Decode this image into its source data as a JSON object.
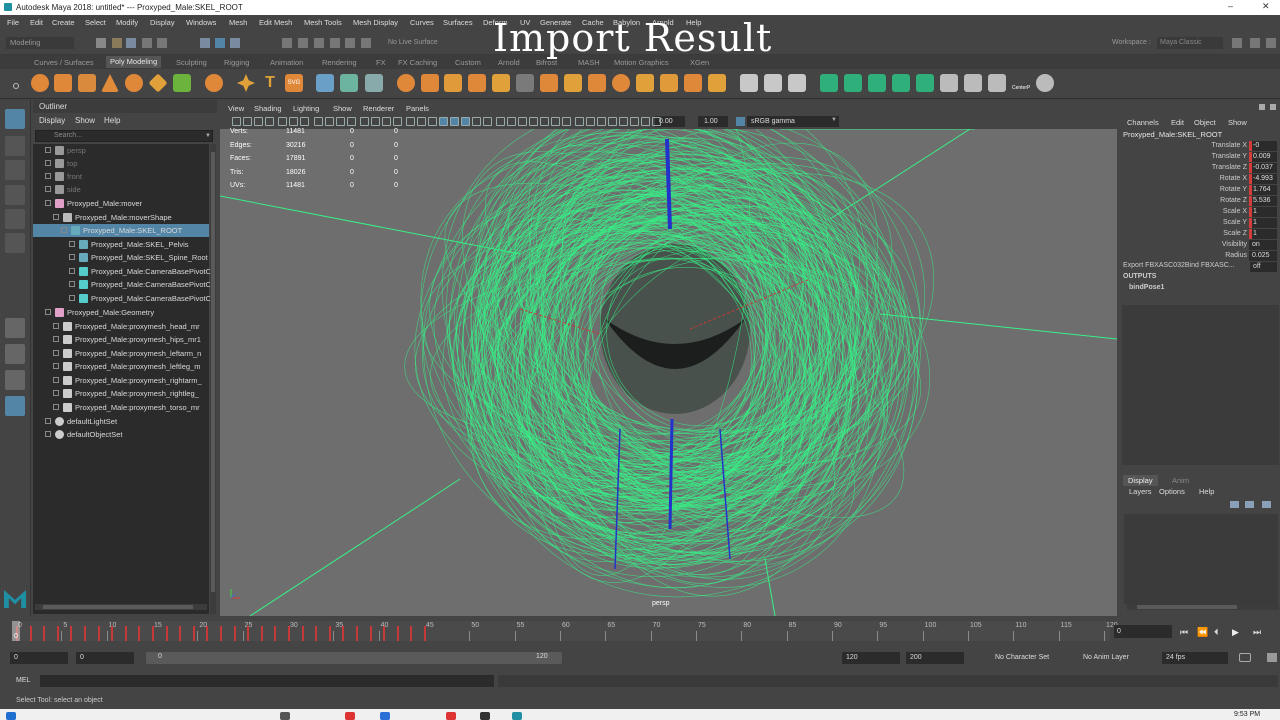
{
  "window": {
    "title": "Autodesk Maya 2018: untitled*   ---   Proxyped_Male:SKEL_ROOT",
    "minimize": "–",
    "close": "✕"
  },
  "overlay_caption": "Import Result",
  "menubar": [
    "File",
    "Edit",
    "Create",
    "Select",
    "Modify",
    "Display",
    "Windows",
    "Mesh",
    "Edit Mesh",
    "Mesh Tools",
    "Mesh Display",
    "Curves",
    "Surfaces",
    "Deform",
    "UV",
    "Generate",
    "Cache",
    "Babylon",
    "Arnold",
    "Help"
  ],
  "statusline": {
    "mode": "Modeling",
    "live_surface": "No Live Surface",
    "workspace_label": "Workspace :",
    "workspace_value": "Maya Classic"
  },
  "shelf_tabs": [
    "Curves / Surfaces",
    "Poly Modeling",
    "Sculpting",
    "Rigging",
    "Animation",
    "Rendering",
    "FX",
    "FX Caching",
    "Custom",
    "Arnold",
    "Bifrost",
    "MASH",
    "Motion Graphics",
    "XGen"
  ],
  "shelf_active": "Poly Modeling",
  "shelf_text_icons": {
    "type": "T",
    "svg": "SVG",
    "center": "CenterP"
  },
  "outliner": {
    "title": "Outliner",
    "menus": [
      "Display",
      "Show",
      "Help"
    ],
    "search_placeholder": "Search...",
    "rows": [
      {
        "label": "persp",
        "dim": true
      },
      {
        "label": "top",
        "dim": true
      },
      {
        "label": "front",
        "dim": true
      },
      {
        "label": "side",
        "dim": true
      },
      {
        "label": "Proxyped_Male:mover"
      },
      {
        "label": "Proxyped_Male:moverShape"
      },
      {
        "label": "Proxyped_Male:SKEL_ROOT",
        "selected": true
      },
      {
        "label": "Proxyped_Male:SKEL_Pelvis"
      },
      {
        "label": "Proxyped_Male:SKEL_Spine_Root"
      },
      {
        "label": "Proxyped_Male:CameraBasePivotO"
      },
      {
        "label": "Proxyped_Male:CameraBasePivotO"
      },
      {
        "label": "Proxyped_Male:CameraBasePivotO"
      },
      {
        "label": "Proxyped_Male:Geometry"
      },
      {
        "label": "Proxyped_Male:proxymesh_head_mr"
      },
      {
        "label": "Proxyped_Male:proxymesh_hips_mr1"
      },
      {
        "label": "Proxyped_Male:proxymesh_leftarm_n"
      },
      {
        "label": "Proxyped_Male:proxymesh_leftleg_m"
      },
      {
        "label": "Proxyped_Male:proxymesh_rightarm_"
      },
      {
        "label": "Proxyped_Male:proxymesh_rightleg_"
      },
      {
        "label": "Proxyped_Male:proxymesh_torso_mr"
      },
      {
        "label": "defaultLightSet"
      },
      {
        "label": "defaultObjectSet"
      }
    ]
  },
  "viewport": {
    "menus": [
      "View",
      "Shading",
      "Lighting",
      "Show",
      "Renderer",
      "Panels"
    ],
    "field_a": "0.00",
    "field_b": "1.00",
    "color_space": "sRGB gamma",
    "camera_label": "persp",
    "hud": [
      {
        "label": "Verts:",
        "v1": "11481",
        "v2": "0",
        "v3": "0"
      },
      {
        "label": "Edges:",
        "v1": "30216",
        "v2": "0",
        "v3": "0"
      },
      {
        "label": "Faces:",
        "v1": "17891",
        "v2": "0",
        "v3": "0"
      },
      {
        "label": "Tris:",
        "v1": "18026",
        "v2": "0",
        "v3": "0"
      },
      {
        "label": "UVs:",
        "v1": "11481",
        "v2": "0",
        "v3": "0"
      }
    ],
    "wire_color": "#38f087"
  },
  "channelbox": {
    "menus": [
      "Channels",
      "Edit",
      "Object",
      "Show"
    ],
    "node": "Proxyped_Male:SKEL_ROOT",
    "attrs": [
      {
        "name": "Translate X",
        "value": "-0",
        "keyed": true
      },
      {
        "name": "Translate Y",
        "value": "0.009",
        "keyed": true
      },
      {
        "name": "Translate Z",
        "value": "-0.037",
        "keyed": true
      },
      {
        "name": "Rotate X",
        "value": "-4.993",
        "keyed": true
      },
      {
        "name": "Rotate Y",
        "value": "1.764",
        "keyed": true
      },
      {
        "name": "Rotate Z",
        "value": "5.536",
        "keyed": true
      },
      {
        "name": "Scale X",
        "value": "1",
        "keyed": true
      },
      {
        "name": "Scale Y",
        "value": "1",
        "keyed": true
      },
      {
        "name": "Scale Z",
        "value": "1",
        "keyed": true
      },
      {
        "name": "Visibility",
        "value": "on",
        "keyed": false
      },
      {
        "name": "Radius",
        "value": "0.025",
        "keyed": false
      }
    ],
    "extra_attr_name": "Export FBXASC032Bind FBXASC...",
    "extra_attr_value": "off",
    "outputs_label": "OUTPUTS",
    "output_node": "bindPose1"
  },
  "layers": {
    "tabs": [
      "Display",
      "Anim"
    ],
    "menus": [
      "Layers",
      "Options",
      "Help"
    ]
  },
  "timeline": {
    "ticks": [
      "0",
      "5",
      "10",
      "15",
      "20",
      "25",
      "30",
      "35",
      "40",
      "45",
      "50",
      "55",
      "60",
      "65",
      "70",
      "75",
      "80",
      "85",
      "90",
      "95",
      "100",
      "105",
      "110",
      "115",
      "120"
    ],
    "current_frame": "0",
    "current_field": "0",
    "playback_buttons": [
      "⏮",
      "⏪",
      "⏴",
      "▶",
      "⏭"
    ]
  },
  "range": {
    "start": "0",
    "anim_start": "0",
    "slider_start": "0",
    "slider_end": "120",
    "end": "120",
    "anim_end": "200",
    "character_set": "No Character Set",
    "anim_layer": "No Anim Layer",
    "fps": "24 fps"
  },
  "cmdline": {
    "mel_label": "MEL",
    "help_text": "Select Tool: select an object"
  },
  "taskbar": {
    "clock": "9:53 PM"
  }
}
